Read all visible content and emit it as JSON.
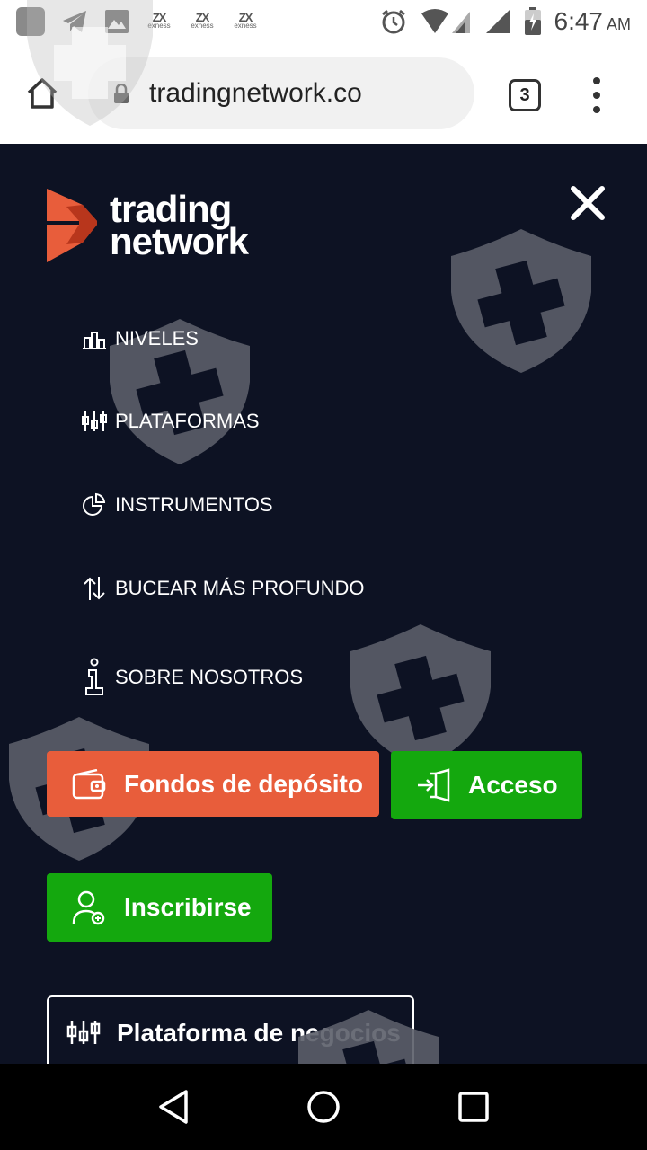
{
  "status_bar": {
    "time": "6:47",
    "ampm": "AM",
    "icons": [
      "app-icon",
      "telegram-icon",
      "gallery-icon",
      "exness-icon",
      "exness-icon",
      "exness-icon",
      "alarm-icon",
      "wifi-icon",
      "signal-icon",
      "signal-icon",
      "battery-charging-icon"
    ],
    "exness_label": "exness"
  },
  "browser": {
    "url": "tradingnetwork.co",
    "tab_count": "3"
  },
  "logo": {
    "line1": "trading",
    "line2": "network",
    "colors": {
      "orange": "#e85d3b",
      "dark_orange": "#b8361c"
    }
  },
  "menu": {
    "items": [
      {
        "label": "NIVELES",
        "icon": "levels-icon"
      },
      {
        "label": "PLATAFORMAS",
        "icon": "sliders-icon"
      },
      {
        "label": "INSTRUMENTOS",
        "icon": "pie-chart-icon"
      },
      {
        "label": "BUCEAR MÁS PROFUNDO",
        "icon": "arrows-up-down-icon"
      },
      {
        "label": "SOBRE NOSOTROS",
        "icon": "info-icon"
      }
    ]
  },
  "buttons": {
    "deposit": "Fondos de depósito",
    "login": "Acceso",
    "signup": "Inscribirse",
    "platform": "Plataforma de negocios"
  },
  "colors": {
    "background": "#0d1223",
    "deposit": "#e85d3b",
    "green": "#14a80e"
  }
}
